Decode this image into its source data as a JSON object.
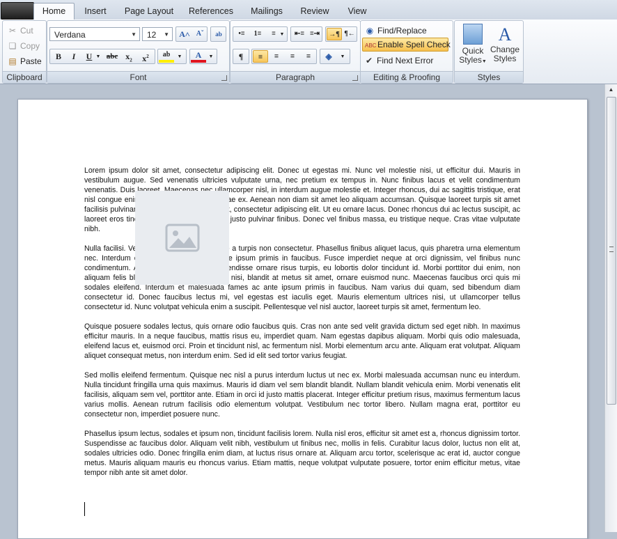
{
  "tabs": [
    "Home",
    "Insert",
    "Page Layout",
    "References",
    "Mailings",
    "Review",
    "View"
  ],
  "clipboard": {
    "label": "Clipboard",
    "cut": "Cut",
    "copy": "Copy",
    "paste": "Paste"
  },
  "font": {
    "label": "Font",
    "name": "Verdana",
    "size": "12"
  },
  "paragraph": {
    "label": "Paragraph"
  },
  "editing": {
    "label": "Editing & Proofing",
    "find_replace": "Find/Replace",
    "spell_check": "Enable Spell Check",
    "find_next_error": "Find Next Error"
  },
  "styles": {
    "label": "Styles",
    "quick_1": "Quick",
    "quick_2": "Styles",
    "change_1": "Change",
    "change_2": "Styles"
  },
  "document": {
    "paragraphs": [
      "Lorem ipsum dolor sit amet, consectetur adipiscing elit. Donec ut egestas mi. Nunc vel molestie nisi, ut efficitur dui. Mauris in vestibulum augue. Sed venenatis ultricies vulputate urna, nec pretium ex tempus in. Nunc finibus lacus et velit condimentum venenatis. Duis laoreet. Maecenas nec ullamcorper nisl, in interdum augue molestie et. Integer rhoncus, dui ac sagittis tristique, erat nisl congue enim, ut ullamcorper elit nisi vitae ex. Aenean non diam sit amet leo aliquam accumsan. Quisque laoreet turpis sit amet facilisis pulvinar. Lorem ipsum dolor sit amet, consectetur adipiscing elit. Ut eu ornare lacus. Donec rhoncus dui ac lectus suscipit, ac laoreet eros tincidunt. Cras nec gravida vel justo pulvinar finibus. Donec vel finibus massa, eu tristique neque. Cras vitae vulputate nibh.",
      "Nulla facilisi. Vestibulum et tortor est. Fusce a turpis non consectetur. Phasellus finibus aliquet lacus, quis pharetra urna elementum nec. Interdum et malesuada fames ac ante ipsum primis in faucibus. Fusce imperdiet neque at orci dignissim, vel finibus nunc condimentum. Aliquam erat volutpat. Suspendisse ornare risus turpis, eu lobortis dolor tincidunt id. Morbi porttitor dui enim, non aliquam felis blandit non. Vestibulum ligula nisi, blandit at metus sit amet, ornare euismod nunc. Maecenas faucibus orci quis mi sodales eleifend. Interdum et malesuada fames ac ante ipsum primis in faucibus. Nam varius dui quam, sed bibendum diam consectetur id. Donec faucibus lectus mi, vel egestas est iaculis eget. Mauris elementum ultrices nisi, ut ullamcorper tellus consectetur id. Nunc volutpat vehicula enim a suscipit. Pellentesque vel nisl auctor, laoreet turpis sit amet, fermentum leo.",
      "Quisque posuere sodales lectus, quis ornare odio faucibus quis. Cras non ante sed velit gravida dictum sed eget nibh. In maximus efficitur mauris. In a neque faucibus, mattis risus eu, imperdiet quam. Nam egestas dapibus aliquam. Morbi quis odio malesuada, eleifend lacus et, euismod orci. Proin et tincidunt nisl, ac fermentum nisl. Morbi elementum arcu ante. Aliquam erat volutpat. Aliquam aliquet consequat metus, non interdum enim. Sed id elit sed tortor varius feugiat.",
      "Sed mollis eleifend fermentum. Quisque nec nisl a purus interdum luctus ut nec ex. Morbi malesuada accumsan nunc eu interdum. Nulla tincidunt fringilla urna quis maximus. Mauris id diam vel sem blandit blandit. Nullam blandit vehicula enim. Morbi venenatis elit facilisis, aliquam sem vel, porttitor ante. Etiam in orci id justo mattis placerat. Integer efficitur pretium risus, maximus fermentum lacus varius mollis. Aenean rutrum facilisis odio elementum volutpat. Vestibulum nec tortor libero. Nullam magna erat, porttitor eu consectetur non, imperdiet posuere nunc.",
      "Phasellus ipsum lectus, sodales et ipsum non, tincidunt facilisis lorem. Nulla nisl eros, efficitur sit amet est a, rhoncus dignissim tortor. Suspendisse ac faucibus dolor. Aliquam velit nibh, vestibulum ut finibus nec, mollis in felis. Curabitur lacus dolor, luctus non elit at, sodales ultricies odio. Donec fringilla enim diam, at luctus risus ornare at. Aliquam arcu tortor, scelerisque ac erat id, auctor congue metus. Mauris aliquam mauris eu rhoncus varius. Etiam mattis, neque volutpat vulputate posuere, tortor enim efficitur metus, vitae tempor nibh ante sit amet dolor."
    ]
  }
}
